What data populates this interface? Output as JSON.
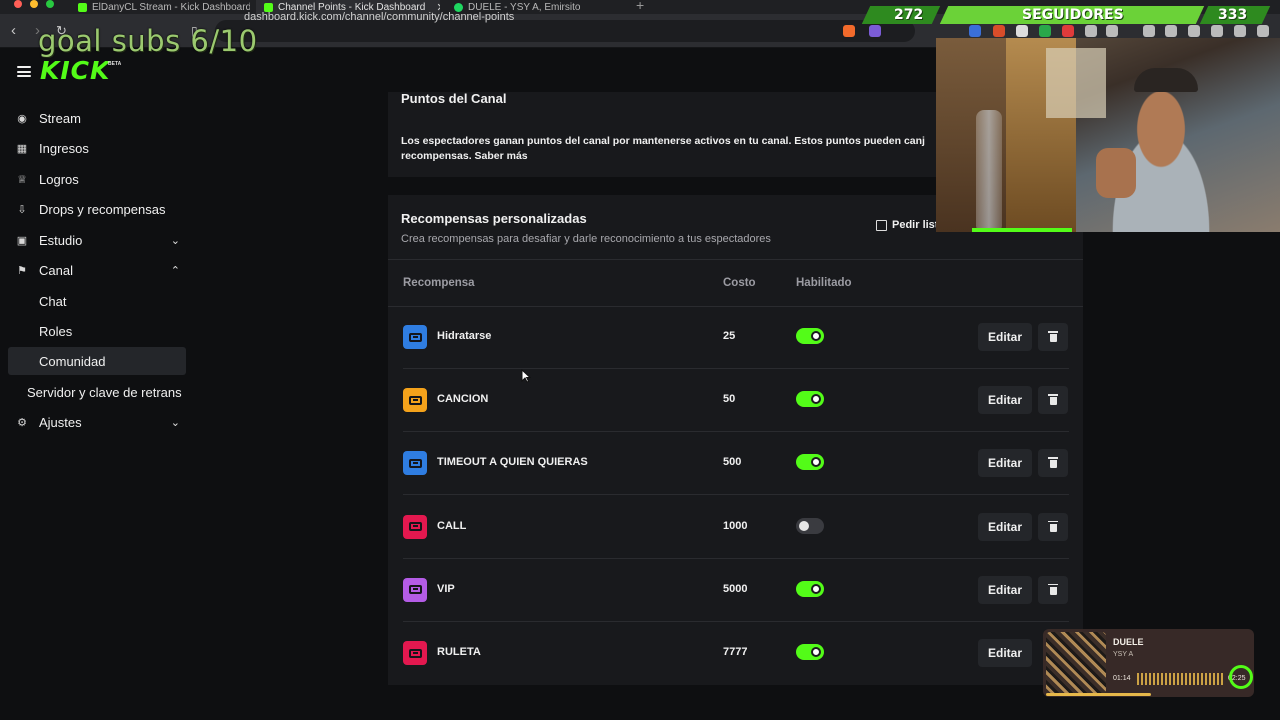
{
  "browser": {
    "tabs": [
      {
        "title": "ElDanyCL Stream - Kick Dashboard"
      },
      {
        "title": "Channel Points - Kick Dashboard",
        "active": true
      },
      {
        "title": "DUELE - YSY A, Emirsito"
      }
    ],
    "url": "dashboard.kick.com/channel/community/channel-points"
  },
  "overlay": {
    "goal_text": "goal subs 6/10",
    "followers_left": "272",
    "followers_label": "SEGUIDORES",
    "followers_right": "333",
    "music": {
      "title": "DUELE",
      "artist": "YSY A",
      "elapsed": "01:14",
      "total": "02:25",
      "progress": 0.51
    }
  },
  "header": {
    "logo": "KICK",
    "logo_badge": "BETA"
  },
  "sidebar": {
    "items": [
      {
        "label": "Stream",
        "icon": "broadcast-icon"
      },
      {
        "label": "Ingresos",
        "icon": "chart-icon"
      },
      {
        "label": "Logros",
        "icon": "trophy-icon"
      },
      {
        "label": "Drops y recompensas",
        "icon": "drops-icon"
      },
      {
        "label": "Estudio",
        "icon": "studio-icon",
        "expandable": true
      },
      {
        "label": "Canal",
        "icon": "channel-icon",
        "expanded": true
      },
      {
        "label": "Chat",
        "sub": true
      },
      {
        "label": "Roles",
        "sub": true
      },
      {
        "label": "Comunidad",
        "sub": true,
        "active": true
      },
      {
        "label": "Servidor y clave de retrans"
      },
      {
        "label": "Ajustes",
        "icon": "gear-icon",
        "expandable": true
      }
    ]
  },
  "channel_points": {
    "title": "Puntos del Canal",
    "description_line1": "Los espectadores ganan puntos del canal por mantenerse activos en tu canal. Estos puntos pueden canj",
    "description_line2": "recompensas. Saber más"
  },
  "rewards": {
    "title": "Recompensas personalizadas",
    "subtitle": "Crea recompensas para desafiar y darle reconocimiento a tus espectadores",
    "request_button": "Pedir list",
    "columns": {
      "reward": "Recompensa",
      "cost": "Costo",
      "enabled": "Habilitado"
    },
    "edit_label": "Editar",
    "items": [
      {
        "name": "Hidratarse",
        "cost": "25",
        "enabled": true,
        "color": "#2f7de1"
      },
      {
        "name": "CANCION",
        "cost": "50",
        "enabled": true,
        "color": "#f4a21b"
      },
      {
        "name": "TIMEOUT A QUIEN QUIERAS",
        "cost": "500",
        "enabled": true,
        "color": "#2f7de1"
      },
      {
        "name": "CALL",
        "cost": "1000",
        "enabled": false,
        "color": "#e3184f"
      },
      {
        "name": "VIP",
        "cost": "5000",
        "enabled": true,
        "color": "#b45ce6"
      },
      {
        "name": "RULETA",
        "cost": "7777",
        "enabled": true,
        "color": "#e3184f"
      }
    ]
  },
  "colors": {
    "accent": "#53fc18",
    "bg": "#0e0f11",
    "card": "#18191c"
  }
}
